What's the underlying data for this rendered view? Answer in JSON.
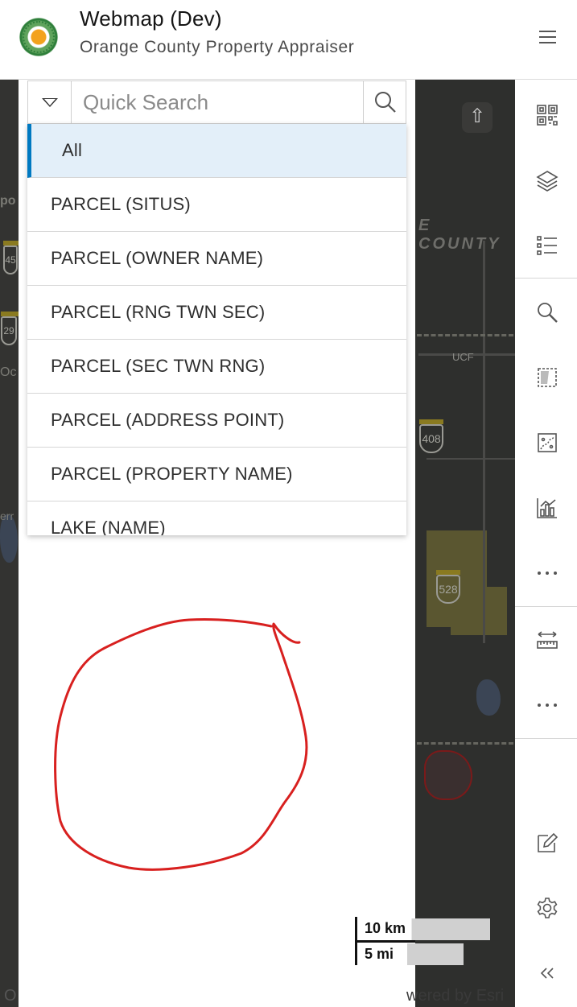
{
  "header": {
    "title": "Webmap (Dev)",
    "subtitle": "Orange County Property Appraiser",
    "menu_icon": "hamburger-menu-icon"
  },
  "search": {
    "placeholder": "Quick Search",
    "dropdown_icon": "chevron-down-icon",
    "search_icon": "search-icon"
  },
  "dropdown": {
    "selected": "All",
    "items": [
      "All",
      "PARCEL (SITUS)",
      "PARCEL (OWNER NAME)",
      "PARCEL (RNG TWN SEC)",
      "PARCEL (SEC TWN RNG)",
      "PARCEL (ADDRESS POINT)",
      "PARCEL (PROPERTY NAME)",
      "LAKE (NAME)"
    ],
    "active_color": "#0079c1"
  },
  "map": {
    "label_county": "E COUNTY",
    "label_ucf": "UCF",
    "shields": [
      "408",
      "528",
      "45",
      "29"
    ],
    "compass_glyph": "⇧",
    "edge_labels": [
      "po",
      "Oc",
      "err"
    ],
    "attribution": "wered by Esri",
    "bottom_left": "O"
  },
  "scale": {
    "km": "10 km",
    "mi": "5 mi"
  },
  "toolbar": {
    "tools": [
      "qr-code-icon",
      "layers-icon",
      "legend-list-icon",
      "search-zoom-icon",
      "select-parcel-icon",
      "map-sketch-icon",
      "chart-icon",
      "more-options-icon",
      "measure-icon",
      "more-options-icon",
      "edit-icon",
      "settings-icon",
      "collapse-icon"
    ]
  },
  "colors": {
    "annotation_red": "#d8201f",
    "map_dark": "#2b2c2b"
  }
}
